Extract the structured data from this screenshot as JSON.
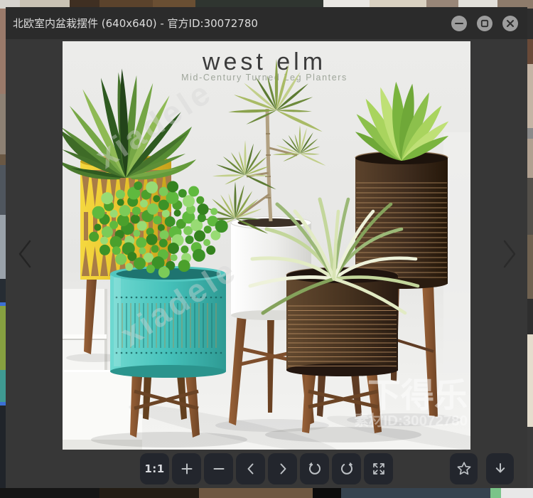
{
  "window": {
    "title": "北欧室内盆栽摆件 (640x640) - 官方ID:30072780",
    "controls": [
      "minimize",
      "maximize",
      "close"
    ]
  },
  "viewer": {
    "nav_prev": "previous image",
    "nav_next": "next image"
  },
  "image": {
    "brand": "west elm",
    "subtitle": "Mid-Century Turned Leg Planters",
    "watermark_diagonal": "xiadele",
    "watermark_brand": "下得乐",
    "watermark_id": "素材ID:30072780"
  },
  "toolbar": {
    "zoom_ratio_label": "1:1",
    "buttons": [
      "one-to-one",
      "zoom-in",
      "zoom-out",
      "previous",
      "next",
      "rotate-left",
      "rotate-right",
      "fullscreen"
    ],
    "actions": [
      "favorite",
      "download"
    ]
  },
  "colors": {
    "overlay": "#373737",
    "titlebar": "#2b2b2b",
    "button_bg": "#23262d",
    "icon": "#bdc1c5",
    "pot_yellow": "#e9c52d",
    "pot_teal": "#45c1ba",
    "pot_white": "#f2f2f0",
    "pot_brown": "#46321f",
    "wood": "#8a5632"
  }
}
